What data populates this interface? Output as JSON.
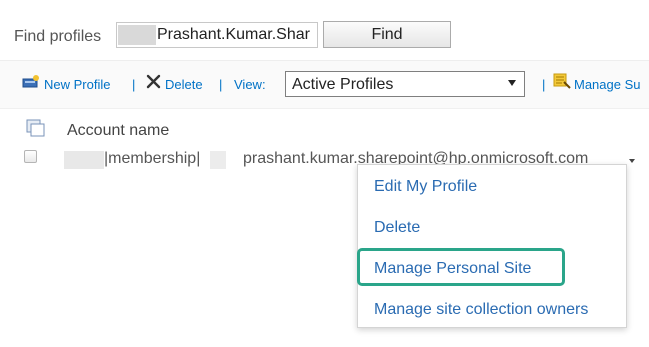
{
  "search": {
    "label": "Find profiles",
    "value": "Prashant.Kumar.Shar",
    "button_label": "Find"
  },
  "toolbar": {
    "new_profile_label": "New Profile",
    "delete_label": "Delete",
    "separator": "|",
    "view_label": "View:",
    "view_selected": "Active Profiles",
    "manage_label": "Manage Su"
  },
  "list": {
    "column_header": "Account name",
    "rows": [
      {
        "account_fragment": "|membership|",
        "email": "prashant.kumar.sharepoint@hp.onmicrosoft.com"
      }
    ]
  },
  "context_menu": {
    "items": [
      "Edit My Profile",
      "Delete",
      "Manage Personal Site",
      "Manage site collection owners"
    ],
    "highlighted_index": 2
  },
  "colors": {
    "link": "#0072c6",
    "menu_link": "#2a6bb2",
    "highlight_border": "#2aa58a"
  },
  "icons": [
    "new-profile-icon",
    "delete-x-icon",
    "manage-sub-icon",
    "select-all-icon",
    "chevron-down-icon"
  ]
}
